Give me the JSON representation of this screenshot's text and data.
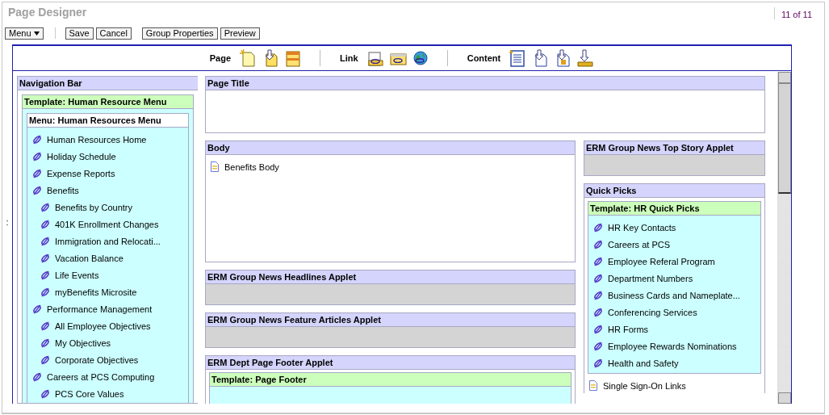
{
  "window": {
    "title": "Page Designer",
    "counter": "11 of 11"
  },
  "toolbar": {
    "menu": "Menu",
    "button_groups": [
      [
        {
          "label": "Save"
        },
        {
          "label": "Cancel"
        }
      ],
      [
        {
          "label": "Group Properties"
        },
        {
          "label": "Preview"
        }
      ]
    ]
  },
  "palette": [
    {
      "label": "Page"
    },
    {
      "label": "Link"
    },
    {
      "label": "Content"
    }
  ],
  "splitter": ":",
  "navigation": {
    "title": "Navigation Bar",
    "template": "Template: Human Resource Menu",
    "menu": "Menu: Human Resources Menu",
    "items": [
      {
        "label": "Human Resources Home"
      },
      {
        "label": "Holiday Schedule"
      },
      {
        "label": "Expense Reports"
      },
      {
        "label": "Benefits",
        "children": [
          {
            "label": "Benefits by Country"
          },
          {
            "label": "401K Enrollment Changes"
          },
          {
            "label": "Immigration and Relocati..."
          },
          {
            "label": "Vacation Balance"
          },
          {
            "label": "Life Events"
          },
          {
            "label": "myBenefits Microsite"
          }
        ]
      },
      {
        "label": "Performance Management",
        "children": [
          {
            "label": "All Employee Objectives"
          },
          {
            "label": "My Objectives"
          },
          {
            "label": "Corporate Objectives"
          }
        ]
      },
      {
        "label": "Careers at PCS Computing",
        "children": [
          {
            "label": "PCS Core Values"
          }
        ]
      }
    ]
  },
  "page_title": {
    "title": "Page Title"
  },
  "body": {
    "title": "Body",
    "items": [
      {
        "label": "Benefits Body"
      }
    ]
  },
  "applets": [
    {
      "title": "ERM Group News Headlines Applet"
    },
    {
      "title": "ERM Group News Feature Articles Applet"
    }
  ],
  "footer": {
    "title": "ERM Dept Page Footer Applet",
    "template": "Template: Page Footer"
  },
  "top_story": {
    "title": "ERM Group News Top Story Applet"
  },
  "quick_picks": {
    "title": "Quick Picks",
    "template": "Template: HR Quick Picks",
    "items": [
      {
        "label": "HR Key Contacts"
      },
      {
        "label": "Careers at PCS"
      },
      {
        "label": "Employee Referal Program"
      },
      {
        "label": "Department Numbers"
      },
      {
        "label": "Business Cards and Nameplate..."
      },
      {
        "label": "Conferencing Services"
      },
      {
        "label": "HR Forms"
      },
      {
        "label": "Employee Rewards Nominations"
      },
      {
        "label": "Health and Safety"
      }
    ],
    "after": [
      {
        "label": "Single Sign-On Links"
      }
    ]
  }
}
